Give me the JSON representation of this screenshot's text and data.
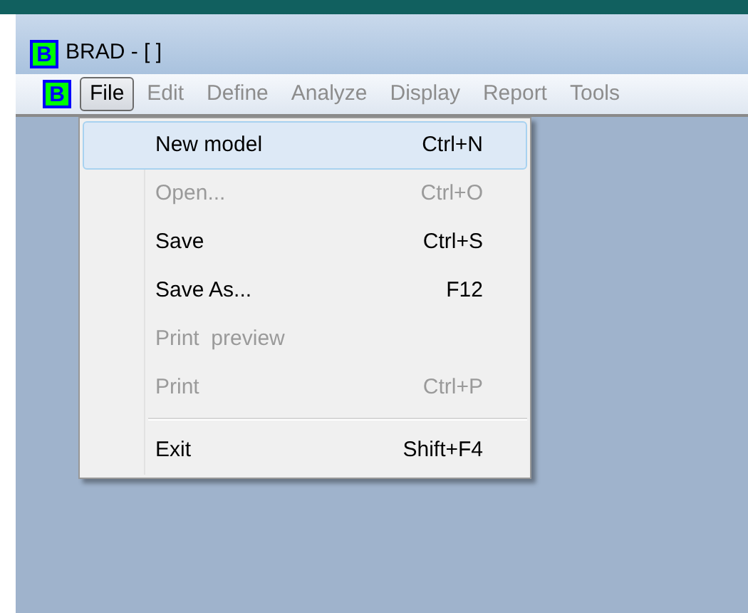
{
  "window": {
    "icon_letter": "B",
    "title": "BRAD - [ ]"
  },
  "menu_bar": {
    "icon_letter": "B",
    "items": [
      {
        "label": "File",
        "selected": true,
        "disabled": false
      },
      {
        "label": "Edit",
        "selected": false,
        "disabled": true
      },
      {
        "label": "Define",
        "selected": false,
        "disabled": true
      },
      {
        "label": "Analyze",
        "selected": false,
        "disabled": true
      },
      {
        "label": "Display",
        "selected": false,
        "disabled": true
      },
      {
        "label": "Report",
        "selected": false,
        "disabled": true
      },
      {
        "label": "Tools",
        "selected": false,
        "disabled": true
      }
    ]
  },
  "file_menu": [
    {
      "kind": "item",
      "label": "New model",
      "shortcut": "Ctrl+N",
      "selected": true,
      "disabled": false
    },
    {
      "kind": "item",
      "label": "Open...",
      "shortcut": "Ctrl+O",
      "selected": false,
      "disabled": true
    },
    {
      "kind": "item",
      "label": "Save",
      "shortcut": "Ctrl+S",
      "selected": false,
      "disabled": false
    },
    {
      "kind": "item",
      "label": "Save As...",
      "shortcut": "F12",
      "selected": false,
      "disabled": false
    },
    {
      "kind": "item",
      "label": "Print  preview",
      "selected": false,
      "disabled": true
    },
    {
      "kind": "item",
      "label": "Print",
      "shortcut": "Ctrl+P",
      "selected": false,
      "disabled": true
    },
    {
      "kind": "separator"
    },
    {
      "kind": "item",
      "label": "Exit",
      "shortcut": "Shift+F4",
      "selected": false,
      "disabled": false
    }
  ]
}
